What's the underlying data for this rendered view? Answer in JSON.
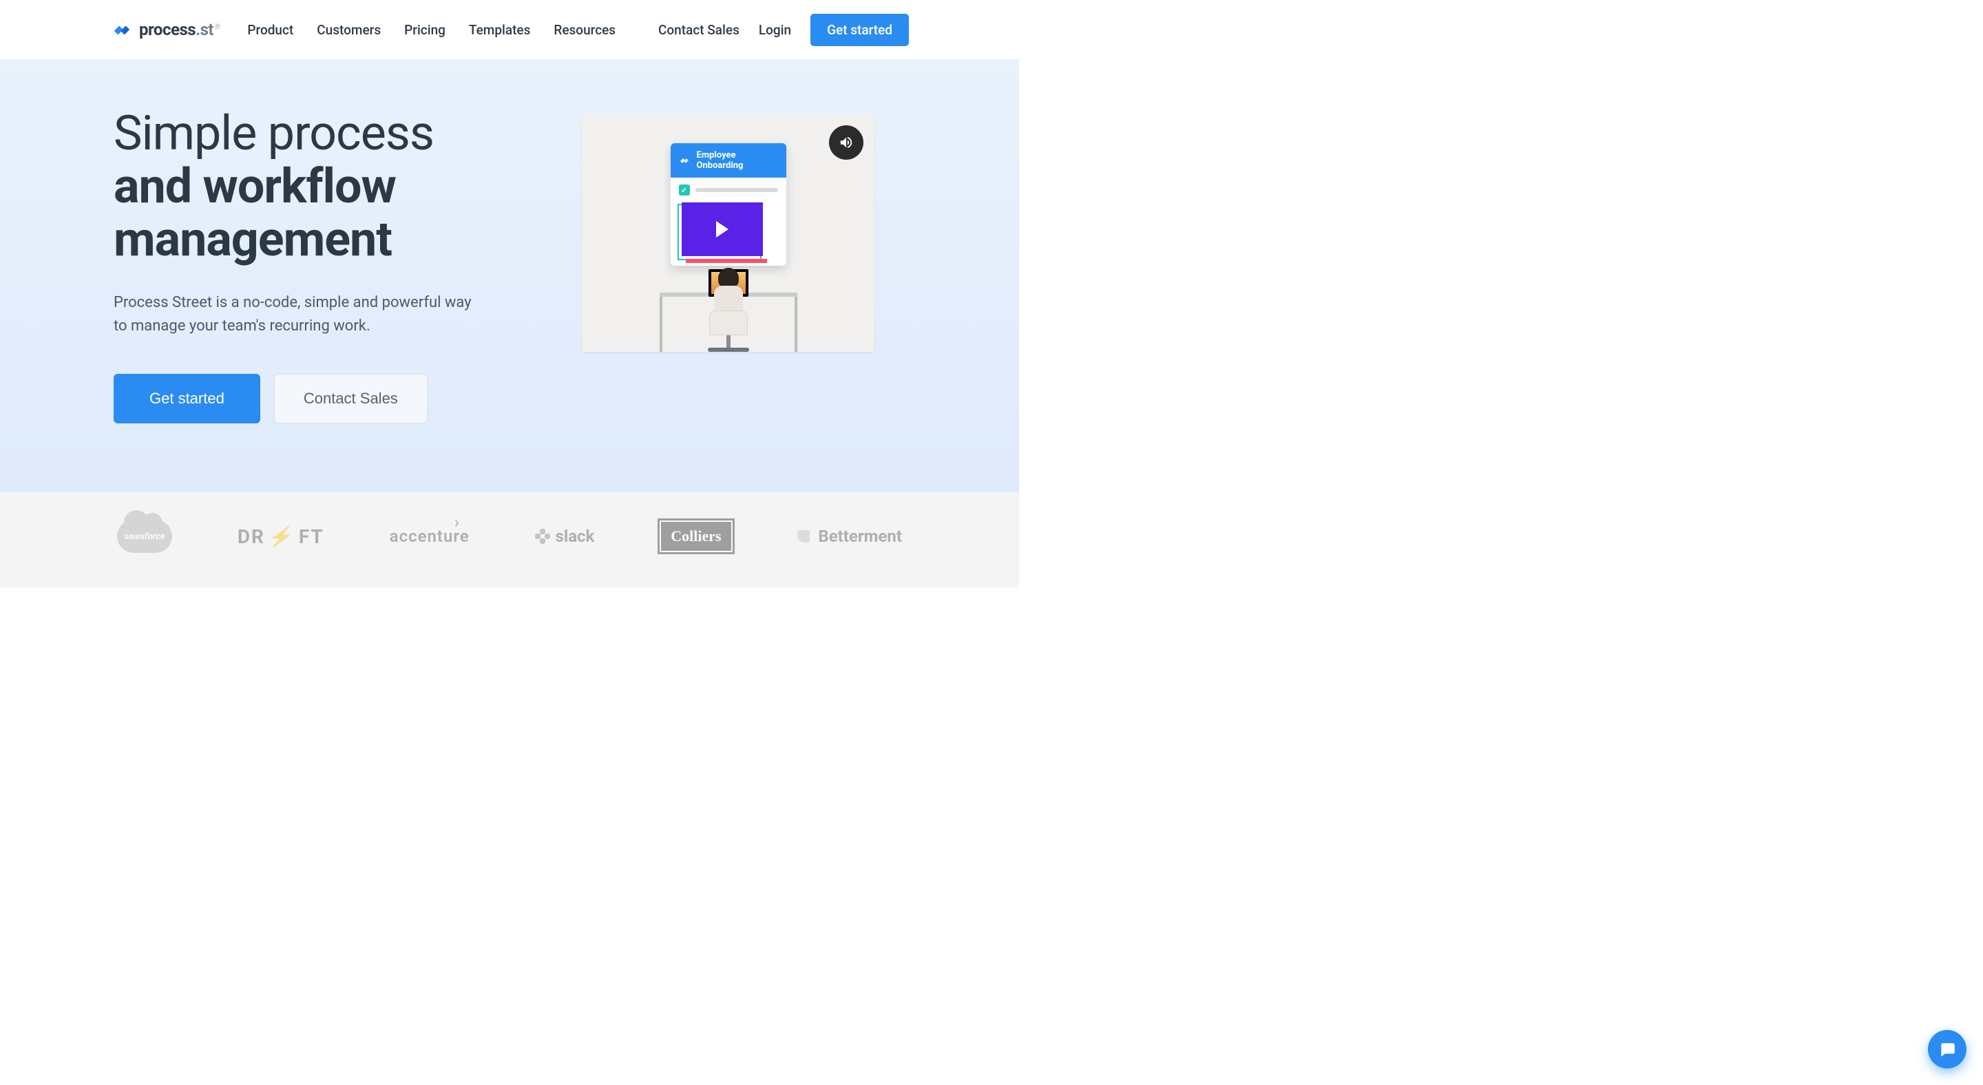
{
  "brand": {
    "name_main": "process",
    "name_dot": ".",
    "name_suffix": "st",
    "trademark": "®"
  },
  "nav": {
    "links": [
      "Product",
      "Customers",
      "Pricing",
      "Templates",
      "Resources"
    ],
    "contact": "Contact Sales",
    "login": "Login",
    "cta": "Get started"
  },
  "hero": {
    "headline_line1": "Simple process",
    "headline_line2": "and workflow",
    "headline_line3": "management",
    "subhead": "Process Street is a no-code, simple and powerful way to manage your team's recurring work.",
    "primary_cta": "Get started",
    "secondary_cta": "Contact Sales"
  },
  "video": {
    "card_title_line1": "Employee",
    "card_title_line2": "Onboarding"
  },
  "logos": {
    "items": [
      "salesforce",
      "DRIFT",
      "accenture",
      "slack",
      "Colliers",
      "Betterment"
    ]
  },
  "icons": {
    "audio": "volume-icon",
    "chat": "chat-icon"
  }
}
